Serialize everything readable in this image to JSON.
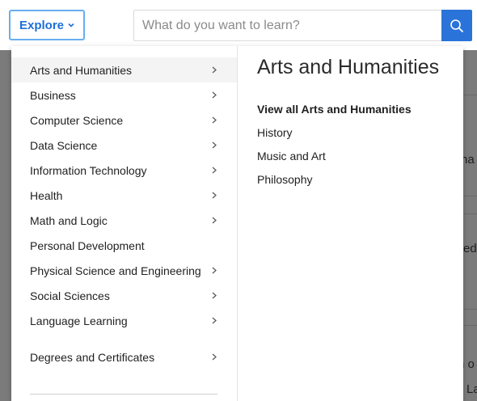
{
  "header": {
    "explore_label": "Explore",
    "search_placeholder": "What do you want to learn?"
  },
  "menu": {
    "categories": [
      {
        "label": "Arts and Humanities",
        "has_submenu": true,
        "active": true
      },
      {
        "label": "Business",
        "has_submenu": true
      },
      {
        "label": "Computer Science",
        "has_submenu": true
      },
      {
        "label": "Data Science",
        "has_submenu": true
      },
      {
        "label": "Information Technology",
        "has_submenu": true
      },
      {
        "label": "Health",
        "has_submenu": true
      },
      {
        "label": "Math and Logic",
        "has_submenu": true
      },
      {
        "label": "Personal Development",
        "has_submenu": false
      },
      {
        "label": "Physical Science and Engineering",
        "has_submenu": true
      },
      {
        "label": "Social Sciences",
        "has_submenu": true
      },
      {
        "label": "Language Learning",
        "has_submenu": true
      },
      {
        "label": "Degrees and Certificates",
        "has_submenu": true
      }
    ],
    "submenu": {
      "title": "Arts and Humanities",
      "links": [
        "View all Arts and Humanities",
        "History",
        "Music and Art",
        "Philosophy"
      ]
    }
  },
  "background_fragments": [
    "ha",
    "ed",
    "n o",
    "La"
  ],
  "colors": {
    "accent": "#2a73d9",
    "explore_text": "#1f6fd6",
    "overlay": "#7b7b7b"
  }
}
